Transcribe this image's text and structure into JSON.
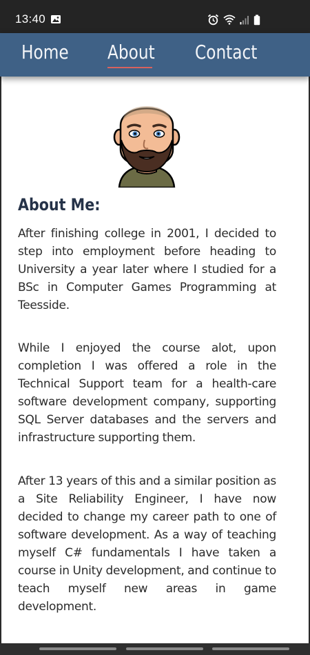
{
  "status_bar": {
    "time": "13:40",
    "left_icons": [
      "image-icon"
    ],
    "right_icons": [
      "alarm-icon",
      "wifi-icon",
      "signal-icon",
      "battery-icon"
    ]
  },
  "nav": {
    "items": [
      {
        "label": "Home",
        "active": false
      },
      {
        "label": "About",
        "active": true
      },
      {
        "label": "Contact",
        "active": false
      }
    ],
    "background": "#3f6186",
    "underline_color": "#d9625d"
  },
  "about": {
    "heading": "About Me:",
    "paragraphs": [
      "After finishing college in 2001, I decided to step into employment before heading to University a year later where I studied for a BSc in Computer Games Programming at Teesside.",
      "While I enjoyed the course alot, upon completion I was offered a role in the Technical Support team for a health-care software development company, supporting SQL Server databases and the servers and infrastructure supporting them.",
      "After 13 years of this and a similar position as a Site Reliability Engineer, I have now decided to change my career path to one of software development. As a way of teaching myself C# fundamentals I have taken a course in Unity development, and continue to teach myself new areas in game development."
    ]
  },
  "colors": {
    "heading": "#253248",
    "text": "#2b2b2b",
    "status_bar": "#242424"
  }
}
